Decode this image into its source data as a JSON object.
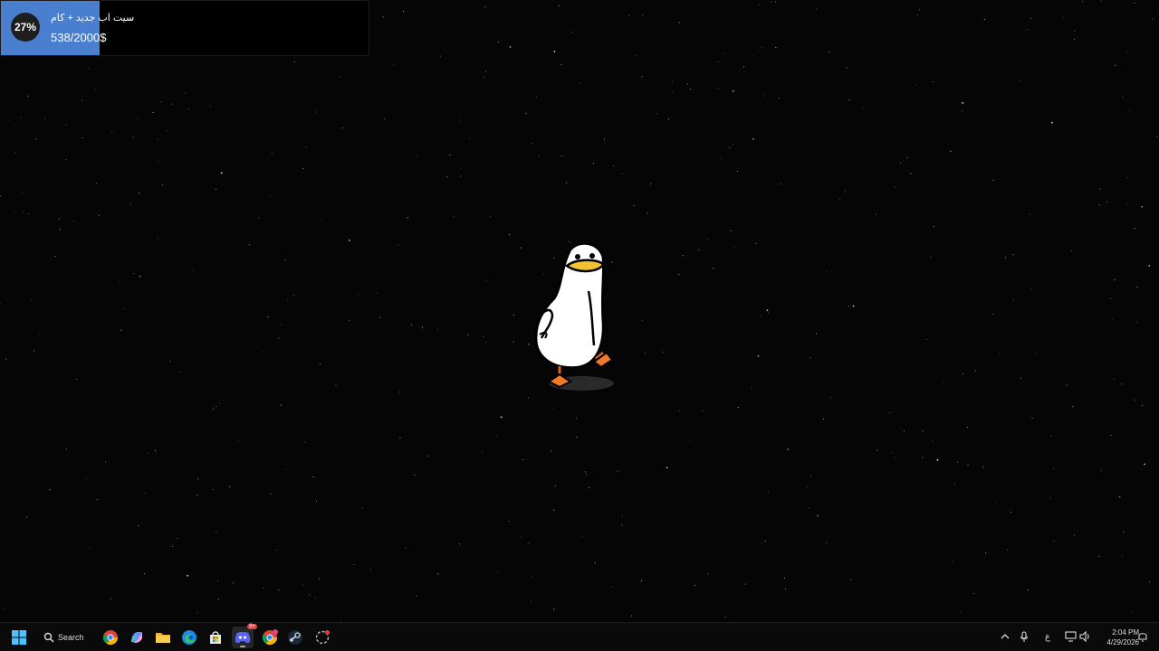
{
  "goal_widget": {
    "percent_label": "27%",
    "progress_fraction": 0.269,
    "title": "سيت اب جديد + كام",
    "amount": "538/2000$",
    "fill_color": "#4a7fd0"
  },
  "desktop": {
    "background": "#050505",
    "pet": "duck"
  },
  "taskbar": {
    "search_label": "Search",
    "icons": [
      "windows-start-icon",
      "search-icon",
      "chrome-icon",
      "copilot-icon",
      "file-explorer-icon",
      "edge-icon",
      "microsoft-store-icon",
      "discord-icon",
      "chrome-profile-icon",
      "steam-icon",
      "app-icon"
    ],
    "discord_badge": "9+",
    "tray": {
      "language": "ع",
      "time": "2:04 PM",
      "date": "4/29/2026"
    }
  }
}
